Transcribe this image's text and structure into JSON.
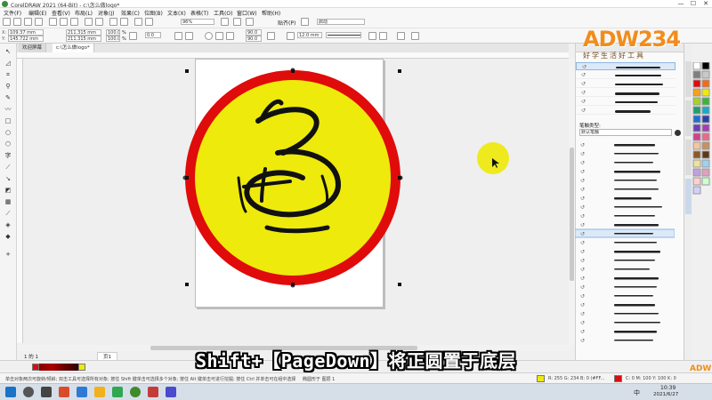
{
  "window": {
    "title": "CorelDRAW 2021 (64-Bit) - c:\\怎么做logo*"
  },
  "window_controls": {
    "minimize": "—",
    "maximize": "☐",
    "close": "✕"
  },
  "menu": [
    "文件(F)",
    "编辑(E)",
    "查看(V)",
    "布局(L)",
    "对象(J)",
    "效果(C)",
    "位图(B)",
    "文本(X)",
    "表格(T)",
    "工具(O)",
    "窗口(W)",
    "帮助(H)"
  ],
  "toolbar": {
    "zoom": "96%",
    "snap_label": "贴齐(P)",
    "launch_label": "启动"
  },
  "propbar": {
    "x": "109.37 mm",
    "y": "145.722 mm",
    "w": "211.315 mm",
    "h": "211.315 mm",
    "sx": "100.0",
    "sy": "100.0",
    "sx_unit": "%",
    "sy_unit": "%",
    "rotation": "0.0",
    "angle1": "90.0",
    "angle2": "90.0",
    "outline_width": "12.0 mm"
  },
  "tabs": [
    "欢迎屏幕",
    "c:\\怎么做logo*"
  ],
  "docker": {
    "header_tabs": [
      "线",
      "条",
      "样",
      "式"
    ],
    "category_label": "笔触类型:",
    "category_value": "默认笔触"
  },
  "page_nav": {
    "label": "1 的 1",
    "page_tab": "页1"
  },
  "status": {
    "hint": "单击对象两次可旋转/倾斜; 双击工具可选择所有对象; 按住 Shift 键单击可选择多个对象; 按住 Alt 键单击可进行挖掘; 按住 Ctrl 并单击可在组中选择",
    "selected": "椭圆形于 图层 1",
    "fill_info": "R: 255 G: 234 B: 0 (#FF...",
    "outline_info": "C: 0 M: 100 Y: 100 K: 0"
  },
  "subtitle": "Shift+【PageDown】将正圆置于底层",
  "watermark": {
    "text": "ADW234",
    "sub": "好学生活好工具",
    "corner": "ADW234"
  },
  "taskbar": {
    "time": "10:39",
    "date": "2021/6/27",
    "ime": "中"
  },
  "colors": {
    "circle_fill": "#eeea0c",
    "circle_outline": "#e00b0b",
    "subtitle_fill": "#ffffff",
    "watermark": "#f28c1a"
  }
}
